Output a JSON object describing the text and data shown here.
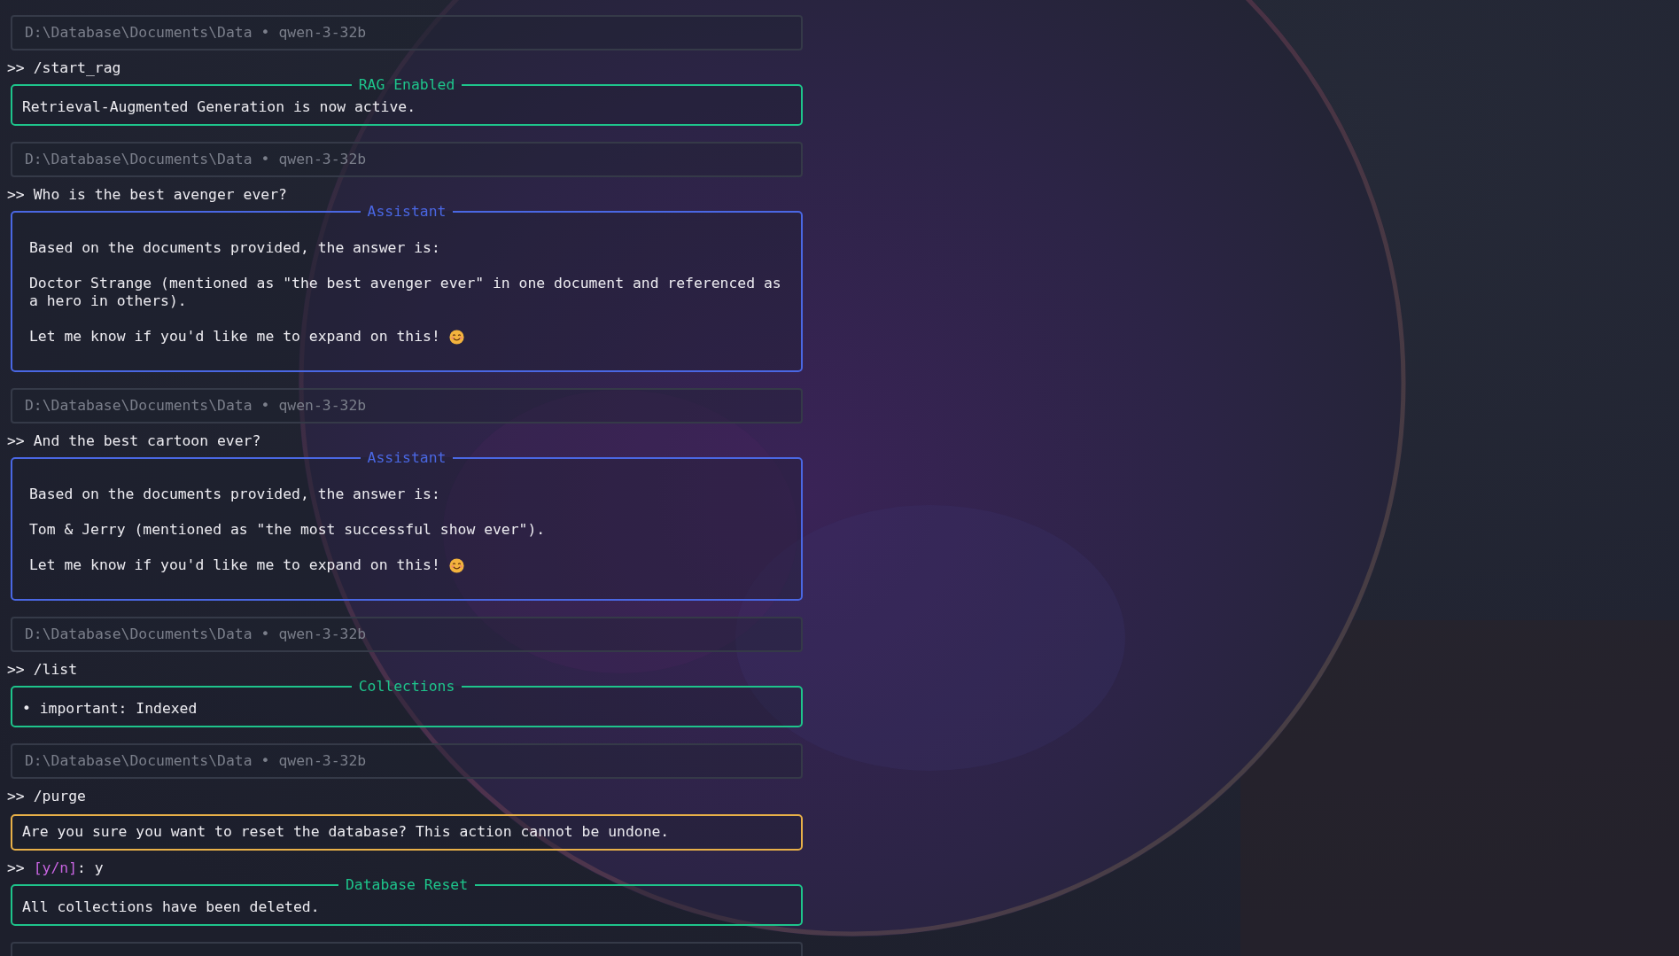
{
  "transcript": [
    {
      "kind": "status",
      "path": "D:\\Database\\Documents\\Data",
      "separator": "•",
      "model": "qwen-3-32b"
    },
    {
      "kind": "prompt",
      "marker": ">>",
      "parts": [
        {
          "text": "/start_rag"
        }
      ]
    },
    {
      "kind": "panel",
      "color": "#1ec48b",
      "title": "RAG Enabled",
      "paragraphs": [
        {
          "text": "Retrieval-Augmented Generation is now active."
        }
      ]
    },
    {
      "kind": "status",
      "path": "D:\\Database\\Documents\\Data",
      "separator": "•",
      "model": "qwen-3-32b"
    },
    {
      "kind": "prompt",
      "marker": ">>",
      "parts": [
        {
          "text": "Who is the best avenger ever?"
        }
      ]
    },
    {
      "kind": "reply",
      "color": "#4a67e3",
      "title": "Assistant",
      "paragraphs": [
        {
          "text": "Based on the documents provided, the answer is:"
        },
        {
          "text": "Doctor Strange (mentioned as \"the best avenger ever\" in one document and referenced as a hero in others)."
        },
        {
          "text": "Let me know if you'd like me to expand on this!",
          "emoji": true
        }
      ]
    },
    {
      "kind": "status",
      "path": "D:\\Database\\Documents\\Data",
      "separator": "•",
      "model": "qwen-3-32b"
    },
    {
      "kind": "prompt",
      "marker": ">>",
      "parts": [
        {
          "text": "And the best cartoon ever?"
        }
      ]
    },
    {
      "kind": "reply",
      "color": "#4a67e3",
      "title": "Assistant",
      "paragraphs": [
        {
          "text": "Based on the documents provided, the answer is:"
        },
        {
          "text": "Tom & Jerry (mentioned as \"the most successful show ever\")."
        },
        {
          "text": "Let me know if you'd like me to expand on this!",
          "emoji": true
        }
      ]
    },
    {
      "kind": "status",
      "path": "D:\\Database\\Documents\\Data",
      "separator": "•",
      "model": "qwen-3-32b"
    },
    {
      "kind": "prompt",
      "marker": ">>",
      "parts": [
        {
          "text": "/list"
        }
      ]
    },
    {
      "kind": "panel",
      "color": "#1ec48b",
      "title": "Collections",
      "paragraphs": [
        {
          "text": "• important: Indexed"
        }
      ]
    },
    {
      "kind": "status",
      "path": "D:\\Database\\Documents\\Data",
      "separator": "•",
      "model": "qwen-3-32b"
    },
    {
      "kind": "prompt",
      "marker": ">>",
      "parts": [
        {
          "text": "/purge"
        }
      ]
    },
    {
      "kind": "panel",
      "color": "#e8b048",
      "paragraphs": [
        {
          "text": "Are you sure you want to reset the database? This action cannot be undone."
        }
      ]
    },
    {
      "kind": "prompt",
      "marker": ">>",
      "parts": [
        {
          "text": "[y/n]",
          "kind": "option"
        },
        {
          "text": ": y"
        }
      ]
    },
    {
      "kind": "panel",
      "color": "#1ec48b",
      "title": "Database Reset",
      "paragraphs": [
        {
          "text": "All collections have been deleted."
        }
      ]
    },
    {
      "kind": "input_frame"
    }
  ]
}
